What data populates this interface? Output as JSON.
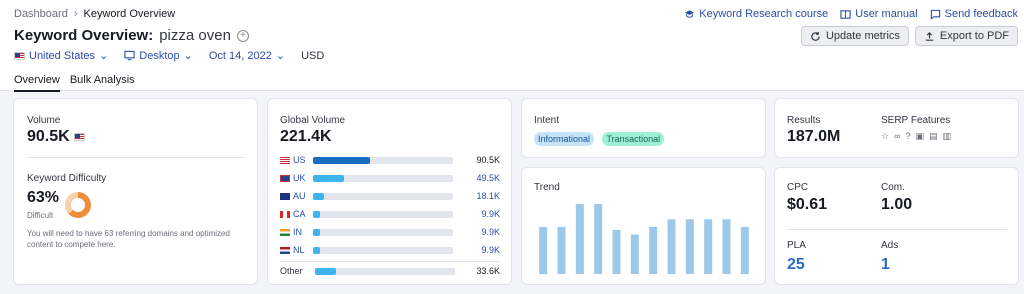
{
  "breadcrumb": {
    "parent": "Dashboard",
    "current": "Keyword Overview"
  },
  "top_links": [
    {
      "label": "Keyword Research course",
      "icon": "graduation-cap-icon"
    },
    {
      "label": "User manual",
      "icon": "book-icon"
    },
    {
      "label": "Send feedback",
      "icon": "chat-icon"
    }
  ],
  "header": {
    "title": "Keyword Overview:",
    "keyword": "pizza oven"
  },
  "buttons": {
    "update_metrics": "Update metrics",
    "export_pdf": "Export to PDF"
  },
  "filters": {
    "country": "United States",
    "device": "Desktop",
    "date": "Oct 14, 2022",
    "currency": "USD"
  },
  "tabs": [
    {
      "label": "Overview",
      "active": true
    },
    {
      "label": "Bulk Analysis",
      "active": false
    }
  ],
  "volume": {
    "label": "Volume",
    "value": "90.5K"
  },
  "difficulty": {
    "label": "Keyword Difficulty",
    "value": "63%",
    "percent": 63,
    "level": "Difficult",
    "note": "You will need to have 63 referring domains and optimized content to compete here."
  },
  "global_volume": {
    "label": "Global Volume",
    "value": "221.4K",
    "countries": [
      {
        "code": "US",
        "value": "90.5K",
        "share": 0.41
      },
      {
        "code": "UK",
        "value": "49.5K",
        "share": 0.22
      },
      {
        "code": "AU",
        "value": "18.1K",
        "share": 0.08
      },
      {
        "code": "CA",
        "value": "9.9K",
        "share": 0.05
      },
      {
        "code": "IN",
        "value": "9.9K",
        "share": 0.05
      },
      {
        "code": "NL",
        "value": "9.9K",
        "share": 0.05
      }
    ],
    "other": {
      "label": "Other",
      "value": "33.6K",
      "share": 0.15
    }
  },
  "intent": {
    "label": "Intent",
    "tags": [
      "Informational",
      "Transactional"
    ]
  },
  "trend": {
    "label": "Trend",
    "values": [
      0.62,
      0.62,
      0.92,
      0.92,
      0.58,
      0.52,
      0.62,
      0.72,
      0.72,
      0.72,
      0.72,
      0.62
    ]
  },
  "results": {
    "label": "Results",
    "value": "187.0M"
  },
  "serp": {
    "label": "SERP Features",
    "icons": [
      "star-icon",
      "link-icon",
      "question-icon",
      "image-icon",
      "image-pack-icon",
      "video-icon"
    ]
  },
  "cpc": {
    "label": "CPC",
    "value": "$0.61"
  },
  "com": {
    "label": "Com.",
    "value": "1.00"
  },
  "pla": {
    "label": "PLA",
    "value": "25"
  },
  "ads": {
    "label": "Ads",
    "value": "1"
  },
  "colors": {
    "link": "#2b4ea8",
    "bar": "#3db4ef",
    "bar_dark": "#1a6ec0",
    "trend_bar": "#9cc8ea",
    "difficulty": "#f08d3b"
  }
}
